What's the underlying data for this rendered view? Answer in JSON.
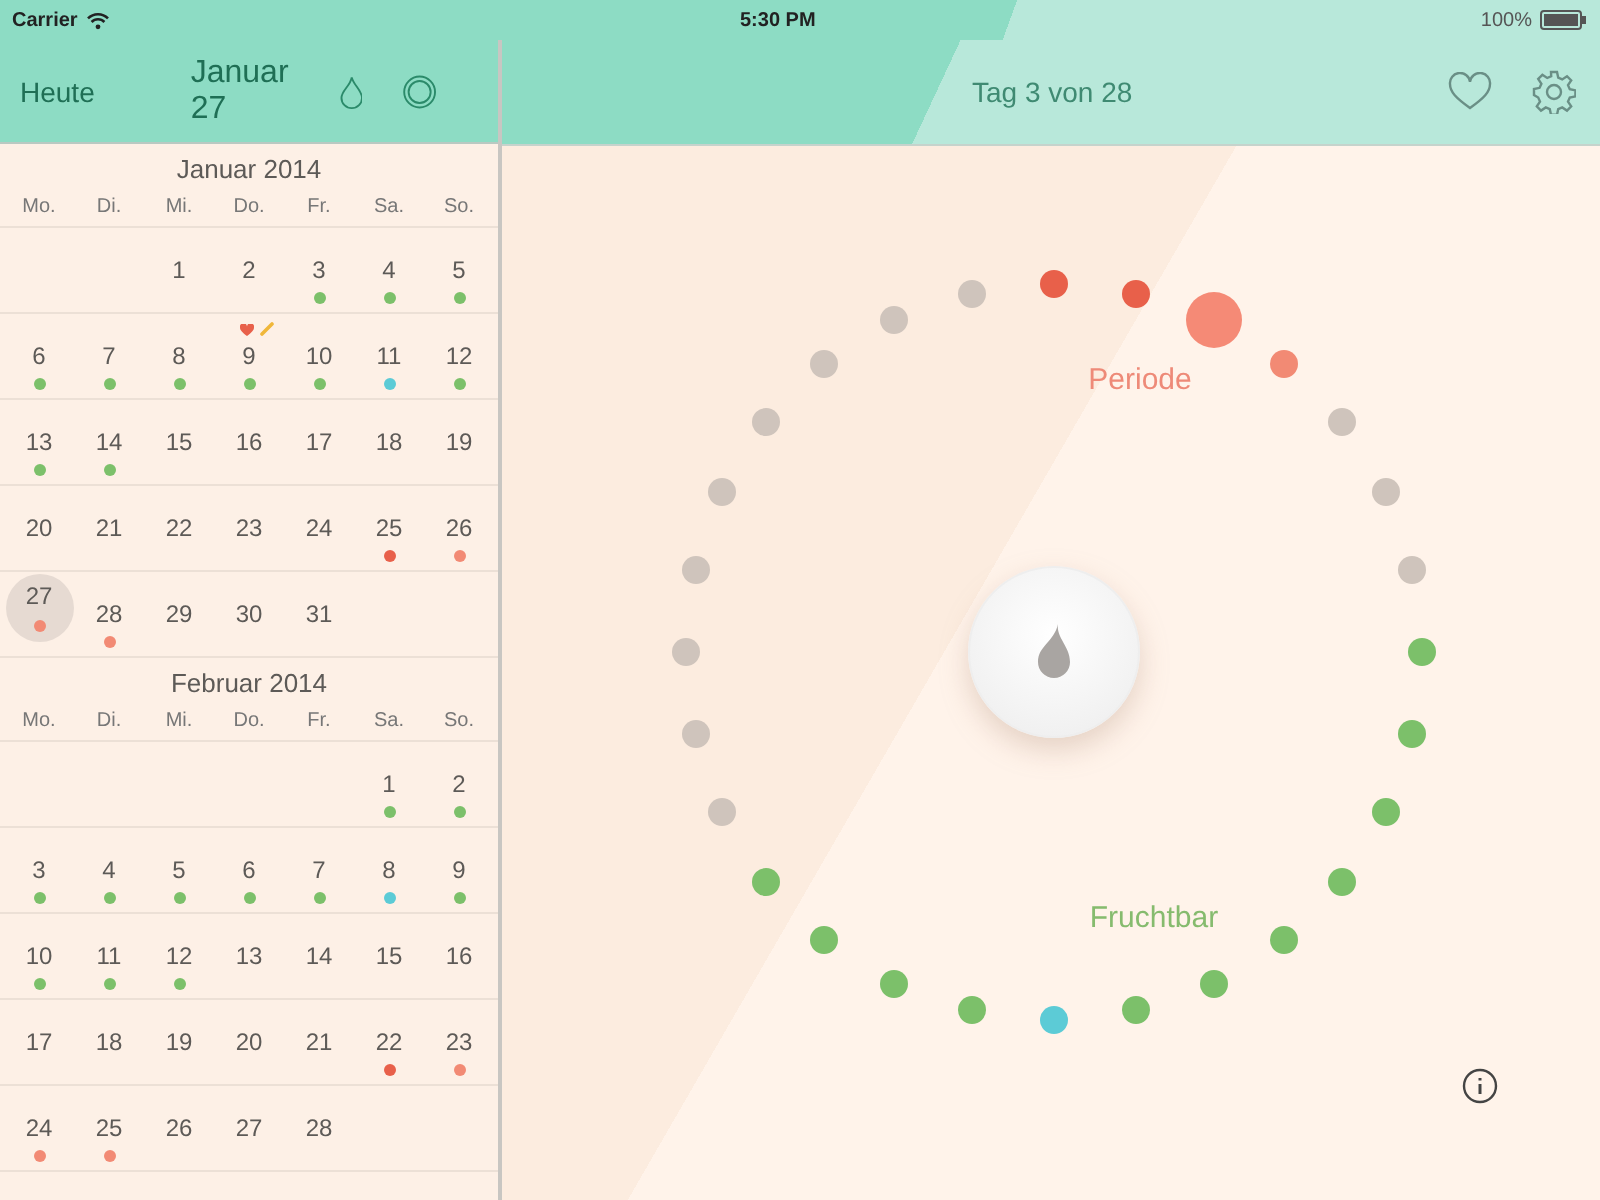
{
  "status_bar": {
    "carrier": "Carrier",
    "time": "5:30 PM",
    "battery": "100%"
  },
  "nav_left": {
    "today_button": "Heute",
    "date": "Januar 27"
  },
  "nav_right": {
    "title": "Tag 3 von 28"
  },
  "months": [
    {
      "title": "Januar 2014",
      "weekdays": [
        "Mo.",
        "Di.",
        "Mi.",
        "Do.",
        "Fr.",
        "Sa.",
        "So."
      ],
      "weeks": [
        [
          {
            "kind": "blank"
          },
          {
            "kind": "blank"
          },
          {
            "kind": "day",
            "day": "1",
            "selected": false
          },
          {
            "kind": "day",
            "day": "2",
            "selected": false
          },
          {
            "kind": "day",
            "day": "3",
            "selected": false,
            "color": "#7cc06a"
          },
          {
            "kind": "day",
            "day": "4",
            "selected": false,
            "color": "#7cc06a"
          },
          {
            "kind": "day",
            "day": "5",
            "selected": false,
            "color": "#7cc06a"
          }
        ],
        [
          {
            "kind": "day",
            "day": "6",
            "selected": false,
            "color": "#7cc06a"
          },
          {
            "kind": "day",
            "day": "7",
            "selected": false,
            "color": "#7cc06a"
          },
          {
            "kind": "day",
            "day": "8",
            "selected": false,
            "color": "#7cc06a"
          },
          {
            "kind": "day",
            "day": "9",
            "selected": false,
            "color": "#7cc06a",
            "tags": [
              {
                "kind": "heart"
              },
              {
                "kind": "pencil"
              }
            ]
          },
          {
            "kind": "day",
            "day": "10",
            "selected": false,
            "color": "#7cc06a"
          },
          {
            "kind": "day",
            "day": "11",
            "selected": false,
            "color": "#5ccbd6"
          },
          {
            "kind": "day",
            "day": "12",
            "selected": false,
            "color": "#7cc06a"
          }
        ],
        [
          {
            "kind": "day",
            "day": "13",
            "selected": false,
            "color": "#7cc06a"
          },
          {
            "kind": "day",
            "day": "14",
            "selected": false,
            "color": "#7cc06a"
          },
          {
            "kind": "day",
            "day": "15",
            "selected": false
          },
          {
            "kind": "day",
            "day": "16",
            "selected": false
          },
          {
            "kind": "day",
            "day": "17",
            "selected": false
          },
          {
            "kind": "day",
            "day": "18",
            "selected": false
          },
          {
            "kind": "day",
            "day": "19",
            "selected": false
          }
        ],
        [
          {
            "kind": "day",
            "day": "20",
            "selected": false
          },
          {
            "kind": "day",
            "day": "21",
            "selected": false
          },
          {
            "kind": "day",
            "day": "22",
            "selected": false
          },
          {
            "kind": "day",
            "day": "23",
            "selected": false
          },
          {
            "kind": "day",
            "day": "24",
            "selected": false
          },
          {
            "kind": "day",
            "day": "25",
            "selected": false,
            "color": "#e8604a"
          },
          {
            "kind": "day",
            "day": "26",
            "selected": false,
            "color": "#f28a74"
          }
        ],
        [
          {
            "kind": "day",
            "day": "27",
            "selected": true,
            "color": "#f28a74"
          },
          {
            "kind": "day",
            "day": "28",
            "selected": false,
            "color": "#f28a74"
          },
          {
            "kind": "day",
            "day": "29",
            "selected": false
          },
          {
            "kind": "day",
            "day": "30",
            "selected": false
          },
          {
            "kind": "day",
            "day": "31",
            "selected": false
          },
          {
            "kind": "blank"
          },
          {
            "kind": "blank"
          }
        ]
      ]
    },
    {
      "title": "Februar 2014",
      "weekdays": [
        "Mo.",
        "Di.",
        "Mi.",
        "Do.",
        "Fr.",
        "Sa.",
        "So."
      ],
      "weeks": [
        [
          {
            "kind": "blank"
          },
          {
            "kind": "blank"
          },
          {
            "kind": "blank"
          },
          {
            "kind": "blank"
          },
          {
            "kind": "blank"
          },
          {
            "kind": "day",
            "day": "1",
            "selected": false,
            "color": "#7cc06a"
          },
          {
            "kind": "day",
            "day": "2",
            "selected": false,
            "color": "#7cc06a"
          }
        ],
        [
          {
            "kind": "day",
            "day": "3",
            "selected": false,
            "color": "#7cc06a"
          },
          {
            "kind": "day",
            "day": "4",
            "selected": false,
            "color": "#7cc06a"
          },
          {
            "kind": "day",
            "day": "5",
            "selected": false,
            "color": "#7cc06a"
          },
          {
            "kind": "day",
            "day": "6",
            "selected": false,
            "color": "#7cc06a"
          },
          {
            "kind": "day",
            "day": "7",
            "selected": false,
            "color": "#7cc06a"
          },
          {
            "kind": "day",
            "day": "8",
            "selected": false,
            "color": "#5ccbd6"
          },
          {
            "kind": "day",
            "day": "9",
            "selected": false,
            "color": "#7cc06a"
          }
        ],
        [
          {
            "kind": "day",
            "day": "10",
            "selected": false,
            "color": "#7cc06a"
          },
          {
            "kind": "day",
            "day": "11",
            "selected": false,
            "color": "#7cc06a"
          },
          {
            "kind": "day",
            "day": "12",
            "selected": false,
            "color": "#7cc06a"
          },
          {
            "kind": "day",
            "day": "13",
            "selected": false
          },
          {
            "kind": "day",
            "day": "14",
            "selected": false
          },
          {
            "kind": "day",
            "day": "15",
            "selected": false
          },
          {
            "kind": "day",
            "day": "16",
            "selected": false
          }
        ],
        [
          {
            "kind": "day",
            "day": "17",
            "selected": false
          },
          {
            "kind": "day",
            "day": "18",
            "selected": false
          },
          {
            "kind": "day",
            "day": "19",
            "selected": false
          },
          {
            "kind": "day",
            "day": "20",
            "selected": false
          },
          {
            "kind": "day",
            "day": "21",
            "selected": false
          },
          {
            "kind": "day",
            "day": "22",
            "selected": false,
            "color": "#e8604a"
          },
          {
            "kind": "day",
            "day": "23",
            "selected": false,
            "color": "#f28a74"
          }
        ],
        [
          {
            "kind": "day",
            "day": "24",
            "selected": false,
            "color": "#f28a74"
          },
          {
            "kind": "day",
            "day": "25",
            "selected": false,
            "color": "#f28a74"
          },
          {
            "kind": "day",
            "day": "26",
            "selected": false
          },
          {
            "kind": "day",
            "day": "27",
            "selected": false
          },
          {
            "kind": "day",
            "day": "28",
            "selected": false
          },
          {
            "kind": "blank"
          },
          {
            "kind": "blank"
          }
        ]
      ]
    }
  ],
  "cycle": {
    "period_label": "Periode",
    "fertile_label": "Fruchtbar",
    "dots": [
      {
        "color": "#e8604a",
        "selected": false
      },
      {
        "color": "#e8604a",
        "selected": false
      },
      {
        "color": "#f58a76",
        "selected": true
      },
      {
        "color": "#f28a74",
        "selected": false
      },
      {
        "color": "#cfc4bc",
        "selected": false
      },
      {
        "color": "#cfc4bc",
        "selected": false
      },
      {
        "color": "#cfc4bc",
        "selected": false
      },
      {
        "color": "#7cc06a",
        "selected": false
      },
      {
        "color": "#7cc06a",
        "selected": false
      },
      {
        "color": "#7cc06a",
        "selected": false
      },
      {
        "color": "#7cc06a",
        "selected": false
      },
      {
        "color": "#7cc06a",
        "selected": false
      },
      {
        "color": "#7cc06a",
        "selected": false
      },
      {
        "color": "#7cc06a",
        "selected": false
      },
      {
        "color": "#5ccbd6",
        "selected": false
      },
      {
        "color": "#7cc06a",
        "selected": false
      },
      {
        "color": "#7cc06a",
        "selected": false
      },
      {
        "color": "#7cc06a",
        "selected": false
      },
      {
        "color": "#7cc06a",
        "selected": false
      },
      {
        "color": "#cfc4bc",
        "selected": false
      },
      {
        "color": "#cfc4bc",
        "selected": false
      },
      {
        "color": "#cfc4bc",
        "selected": false
      },
      {
        "color": "#cfc4bc",
        "selected": false
      },
      {
        "color": "#cfc4bc",
        "selected": false
      },
      {
        "color": "#cfc4bc",
        "selected": false
      },
      {
        "color": "#cfc4bc",
        "selected": false
      },
      {
        "color": "#cfc4bc",
        "selected": false
      },
      {
        "color": "#cfc4bc",
        "selected": false
      }
    ]
  }
}
